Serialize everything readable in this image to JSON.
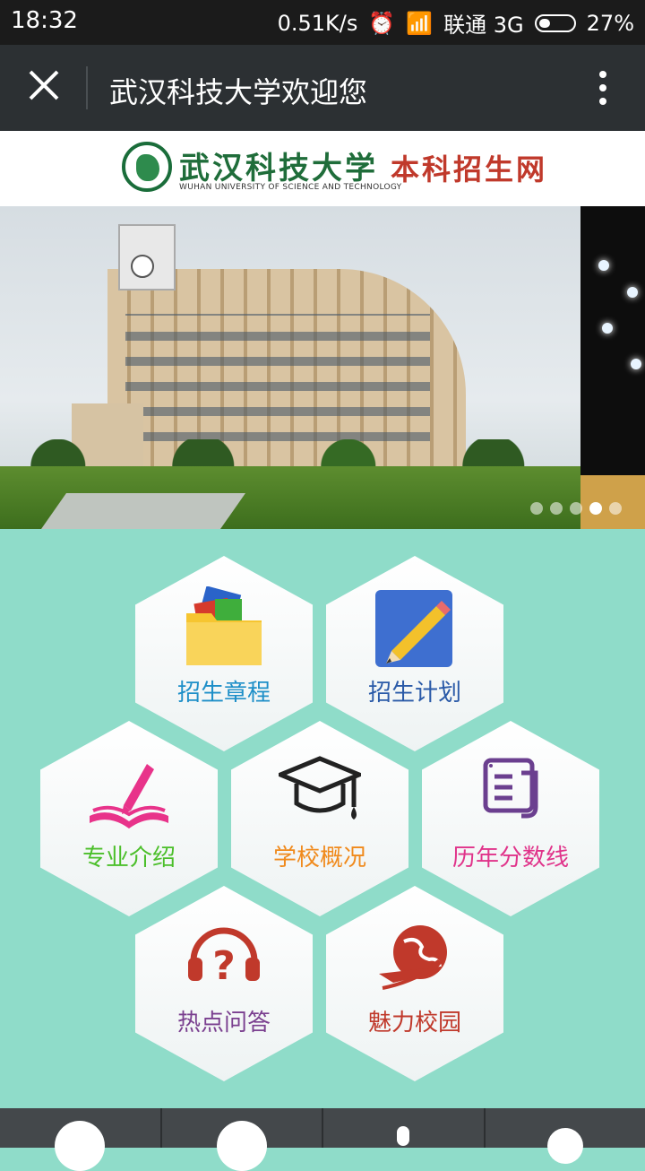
{
  "status_bar": {
    "time": "18:32",
    "speed": "0.51K/s",
    "carrier": "联通 3G",
    "battery": "27%"
  },
  "title_bar": {
    "title": "武汉科技大学欢迎您",
    "close_icon": "close-icon",
    "more_icon": "more-vertical-icon"
  },
  "header": {
    "university_name": "武汉科技大学",
    "university_english": "WUHAN UNIVERSITY OF SCIENCE AND TECHNOLOGY",
    "site_name": "本科招生网"
  },
  "banner": {
    "slide_count": 5,
    "active_slide": 4
  },
  "menu": {
    "items": [
      {
        "label": "招生章程",
        "icon": "folder-icon",
        "color": "#1e8fc8"
      },
      {
        "label": "招生计划",
        "icon": "pencil-icon",
        "color": "#2a5aa8"
      },
      {
        "label": "专业介绍",
        "icon": "book-icon",
        "color": "#4bbf2a"
      },
      {
        "label": "学校概况",
        "icon": "graduation-cap-icon",
        "color": "#f08a1c"
      },
      {
        "label": "历年分数线",
        "icon": "scores-icon",
        "color": "#e0338a"
      },
      {
        "label": "热点问答",
        "icon": "headset-question-icon",
        "color": "#7a3f8f"
      },
      {
        "label": "魅力校园",
        "icon": "globe-plane-icon",
        "color": "#c0392b"
      }
    ]
  },
  "tabbar": {
    "tabs": [
      {
        "icon": "globe-icon"
      },
      {
        "icon": "disc-icon"
      },
      {
        "icon": "location-icon"
      },
      {
        "icon": "clover-icon"
      }
    ]
  }
}
